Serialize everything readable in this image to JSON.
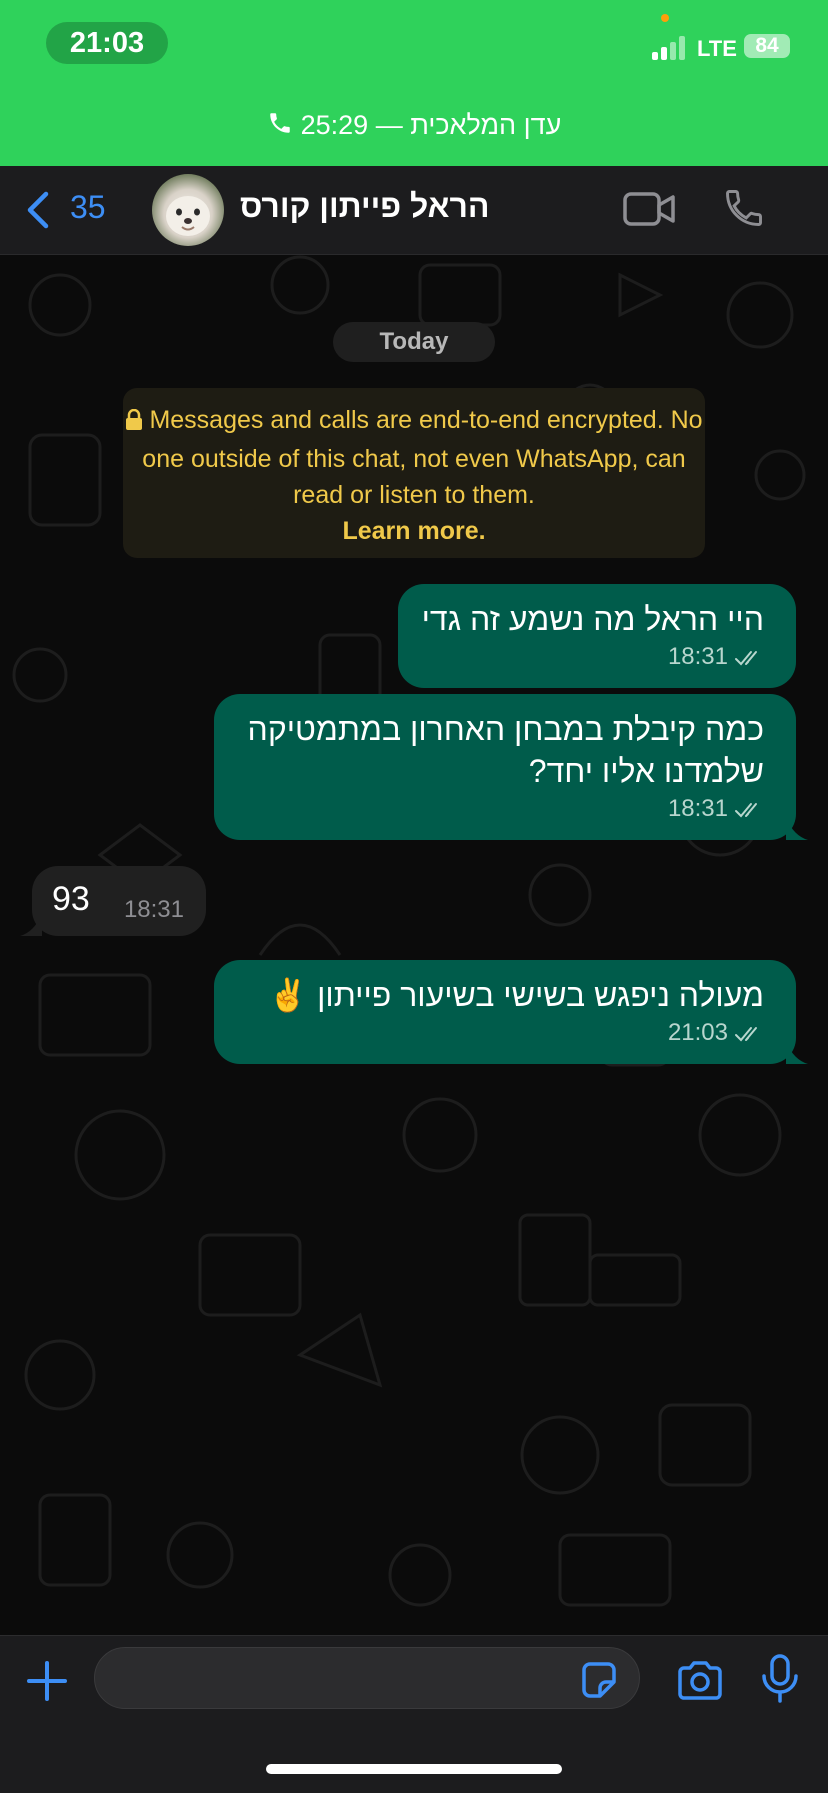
{
  "status_bar": {
    "time": "21:03",
    "network": "LTE",
    "battery": "84",
    "call_banner": "עדן המלאכית — 25:29"
  },
  "header": {
    "back_count": "35",
    "contact_name": "הראל פייתון קורס"
  },
  "chat": {
    "date_label": "Today",
    "encryption_notice": "Messages and calls are end-to-end encrypted. No one outside of this chat, not even WhatsApp, can read or listen to them.",
    "learn_more": "Learn more.",
    "messages": [
      {
        "direction": "outgoing",
        "text": "היי הראל מה נשמע זה גדי",
        "time": "18:31"
      },
      {
        "direction": "outgoing",
        "text": "כמה קיבלת במבחן האחרון במתמטיקה שלמדנו אליו יחד?",
        "time": "18:31"
      },
      {
        "direction": "incoming",
        "text": "93",
        "time": "18:31"
      },
      {
        "direction": "outgoing",
        "text": "מעולה ניפגש בשישי בשיעור פייתון ✌️",
        "time": "21:03"
      }
    ]
  },
  "input_bar": {
    "message_value": ""
  },
  "icons": {
    "back": "chevron-left-icon",
    "video": "video-camera-icon",
    "phone": "phone-icon",
    "plus": "plus-icon",
    "sticker": "sticker-icon",
    "camera": "camera-icon",
    "mic": "microphone-icon"
  },
  "colors": {
    "call_banner": "#2fd25b",
    "outgoing_bubble": "#005c4b",
    "incoming_bubble": "#202020",
    "accent_blue": "#3d8ef5",
    "encryption_text": "#f0c94a"
  }
}
